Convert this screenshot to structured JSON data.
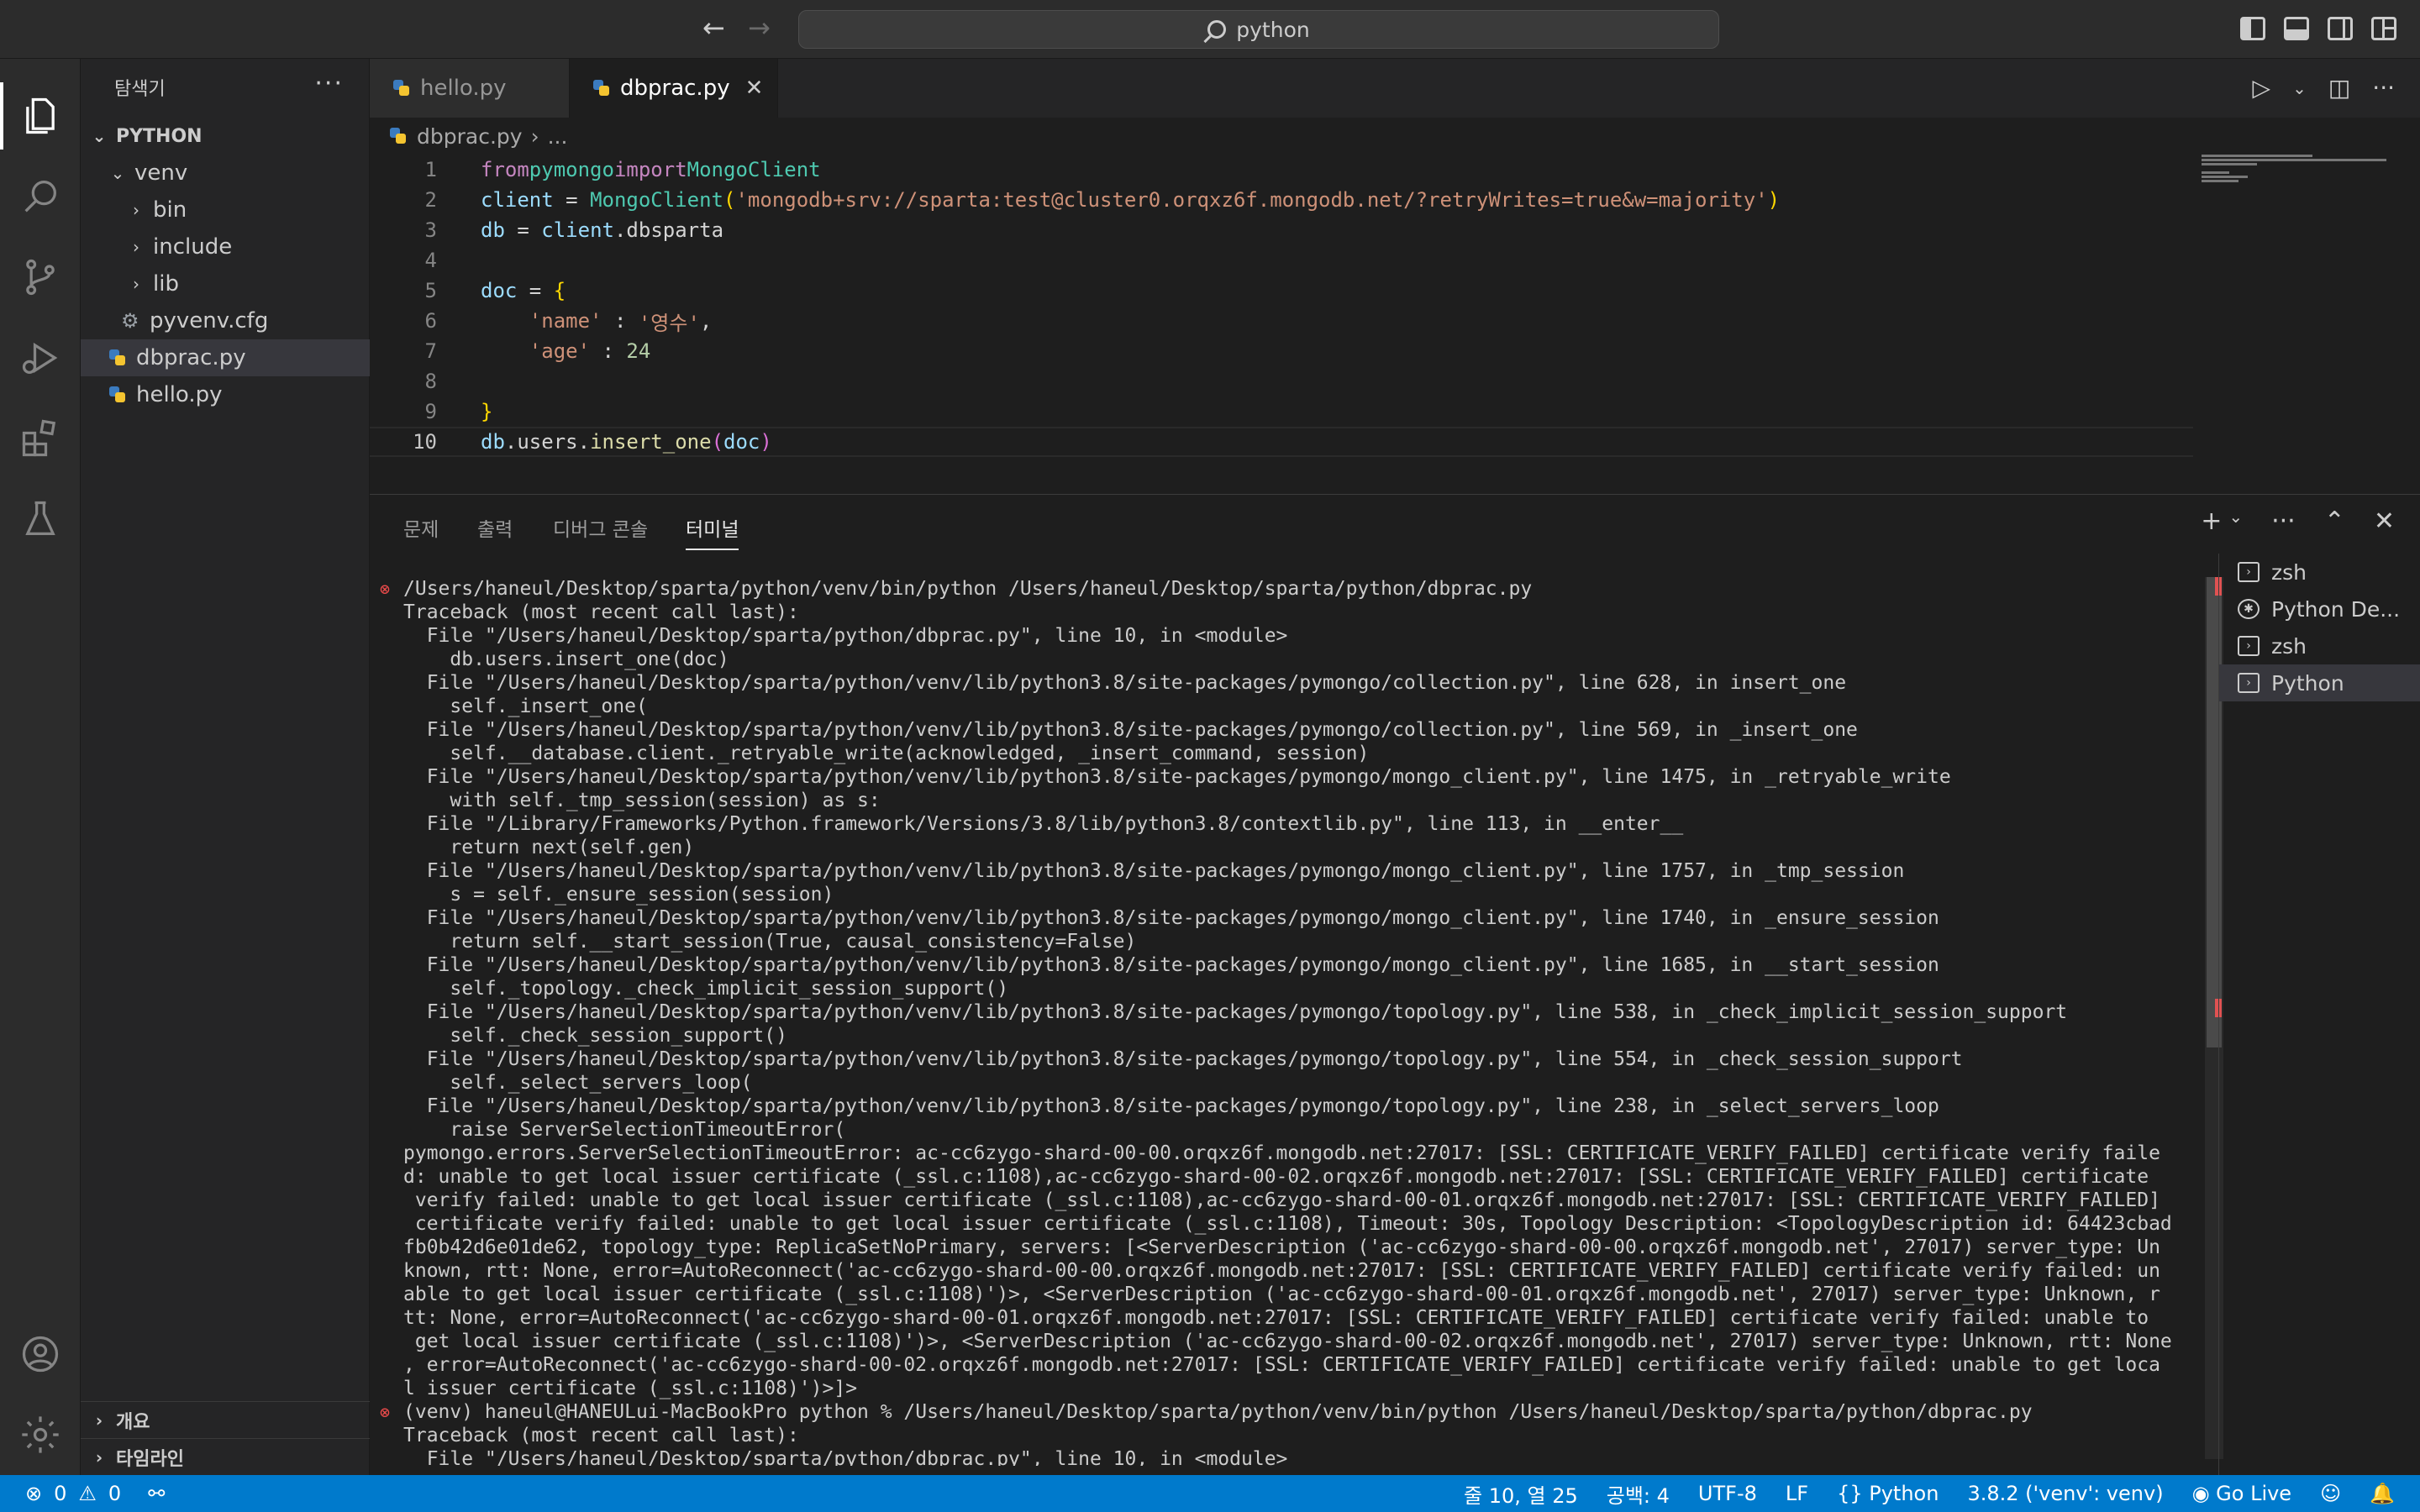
{
  "titlebar": {
    "search_text": "python"
  },
  "sidebar": {
    "header": "탐색기",
    "root": "PYTHON",
    "tree": [
      {
        "label": "venv",
        "type": "folder-open",
        "indent": 1
      },
      {
        "label": "bin",
        "type": "folder",
        "indent": 2
      },
      {
        "label": "include",
        "type": "folder",
        "indent": 2
      },
      {
        "label": "lib",
        "type": "folder",
        "indent": 2
      },
      {
        "label": "pyvenv.cfg",
        "type": "config",
        "indent": 2
      },
      {
        "label": "dbprac.py",
        "type": "python",
        "indent": 1,
        "selected": true
      },
      {
        "label": "hello.py",
        "type": "python",
        "indent": 1
      }
    ],
    "outline": "개요",
    "timeline": "타임라인"
  },
  "tabs": [
    {
      "label": "hello.py",
      "active": false
    },
    {
      "label": "dbprac.py",
      "active": true
    }
  ],
  "breadcrumb": {
    "file": "dbprac.py",
    "rest": "..."
  },
  "code": {
    "line_numbers": [
      "1",
      "2",
      "3",
      "4",
      "5",
      "6",
      "7",
      "8",
      "9",
      "10"
    ],
    "current_line": "10"
  },
  "panel": {
    "tabs": [
      "문제",
      "출력",
      "디버그 콘솔",
      "터미널"
    ],
    "active_tab": "터미널",
    "terminals": [
      {
        "label": "zsh",
        "icon": "terminal-icon"
      },
      {
        "label": "Python De...",
        "icon": "debug-icon"
      },
      {
        "label": "zsh",
        "icon": "terminal-icon"
      },
      {
        "label": "Python",
        "icon": "terminal-icon",
        "active": true
      }
    ],
    "terminal_lines": [
      "/Users/haneul/Desktop/sparta/python/venv/bin/python /Users/haneul/Desktop/sparta/python/dbprac.py",
      "Traceback (most recent call last):",
      "  File \"/Users/haneul/Desktop/sparta/python/dbprac.py\", line 10, in <module>",
      "    db.users.insert_one(doc)",
      "  File \"/Users/haneul/Desktop/sparta/python/venv/lib/python3.8/site-packages/pymongo/collection.py\", line 628, in insert_one",
      "    self._insert_one(",
      "  File \"/Users/haneul/Desktop/sparta/python/venv/lib/python3.8/site-packages/pymongo/collection.py\", line 569, in _insert_one",
      "    self.__database.client._retryable_write(acknowledged, _insert_command, session)",
      "  File \"/Users/haneul/Desktop/sparta/python/venv/lib/python3.8/site-packages/pymongo/mongo_client.py\", line 1475, in _retryable_write",
      "    with self._tmp_session(session) as s:",
      "  File \"/Library/Frameworks/Python.framework/Versions/3.8/lib/python3.8/contextlib.py\", line 113, in __enter__",
      "    return next(self.gen)",
      "  File \"/Users/haneul/Desktop/sparta/python/venv/lib/python3.8/site-packages/pymongo/mongo_client.py\", line 1757, in _tmp_session",
      "    s = self._ensure_session(session)",
      "  File \"/Users/haneul/Desktop/sparta/python/venv/lib/python3.8/site-packages/pymongo/mongo_client.py\", line 1740, in _ensure_session",
      "    return self.__start_session(True, causal_consistency=False)",
      "  File \"/Users/haneul/Desktop/sparta/python/venv/lib/python3.8/site-packages/pymongo/mongo_client.py\", line 1685, in __start_session",
      "    self._topology._check_implicit_session_support()",
      "  File \"/Users/haneul/Desktop/sparta/python/venv/lib/python3.8/site-packages/pymongo/topology.py\", line 538, in _check_implicit_session_support",
      "    self._check_session_support()",
      "  File \"/Users/haneul/Desktop/sparta/python/venv/lib/python3.8/site-packages/pymongo/topology.py\", line 554, in _check_session_support",
      "    self._select_servers_loop(",
      "  File \"/Users/haneul/Desktop/sparta/python/venv/lib/python3.8/site-packages/pymongo/topology.py\", line 238, in _select_servers_loop",
      "    raise ServerSelectionTimeoutError(",
      "pymongo.errors.ServerSelectionTimeoutError: ac-cc6zygo-shard-00-00.orqxz6f.mongodb.net:27017: [SSL: CERTIFICATE_VERIFY_FAILED] certificate verify faile",
      "d: unable to get local issuer certificate (_ssl.c:1108),ac-cc6zygo-shard-00-02.orqxz6f.mongodb.net:27017: [SSL: CERTIFICATE_VERIFY_FAILED] certificate",
      " verify failed: unable to get local issuer certificate (_ssl.c:1108),ac-cc6zygo-shard-00-01.orqxz6f.mongodb.net:27017: [SSL: CERTIFICATE_VERIFY_FAILED]",
      " certificate verify failed: unable to get local issuer certificate (_ssl.c:1108), Timeout: 30s, Topology Description: <TopologyDescription id: 64423cbad",
      "fb0b42d6e01de62, topology_type: ReplicaSetNoPrimary, servers: [<ServerDescription ('ac-cc6zygo-shard-00-00.orqxz6f.mongodb.net', 27017) server_type: Un",
      "known, rtt: None, error=AutoReconnect('ac-cc6zygo-shard-00-00.orqxz6f.mongodb.net:27017: [SSL: CERTIFICATE_VERIFY_FAILED] certificate verify failed: un",
      "able to get local issuer certificate (_ssl.c:1108)')>, <ServerDescription ('ac-cc6zygo-shard-00-01.orqxz6f.mongodb.net', 27017) server_type: Unknown, r",
      "tt: None, error=AutoReconnect('ac-cc6zygo-shard-00-01.orqxz6f.mongodb.net:27017: [SSL: CERTIFICATE_VERIFY_FAILED] certificate verify failed: unable to",
      " get local issuer certificate (_ssl.c:1108)')>, <ServerDescription ('ac-cc6zygo-shard-00-02.orqxz6f.mongodb.net', 27017) server_type: Unknown, rtt: None",
      ", error=AutoReconnect('ac-cc6zygo-shard-00-02.orqxz6f.mongodb.net:27017: [SSL: CERTIFICATE_VERIFY_FAILED] certificate verify failed: unable to get loca",
      "l issuer certificate (_ssl.c:1108)')>]>",
      "(venv) haneul@HANEULui-MacBookPro python % /Users/haneul/Desktop/sparta/python/venv/bin/python /Users/haneul/Desktop/sparta/python/dbprac.py",
      "Traceback (most recent call last):",
      "  File \"/Users/haneul/Desktop/sparta/python/dbprac.py\", line 10, in <module>"
    ]
  },
  "statusbar": {
    "errors": "0",
    "warnings": "0",
    "position": "줄 10, 열 25",
    "spaces": "공백: 4",
    "encoding": "UTF-8",
    "eol": "LF",
    "language": "Python",
    "interpreter": "3.8.2 ('venv': venv)",
    "golive": "Go Live"
  },
  "colors": {
    "accent": "#007acc",
    "editor_bg": "#1e1e1e",
    "error": "#f14c4c"
  }
}
